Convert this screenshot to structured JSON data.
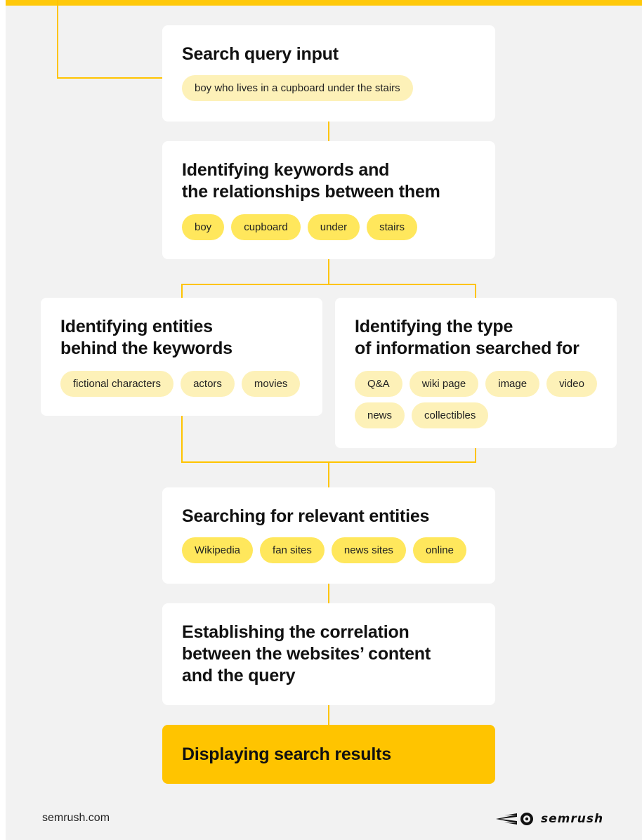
{
  "steps": {
    "query": {
      "title": "Search query input",
      "chips": [
        "boy who lives in a cupboard under the stairs"
      ]
    },
    "keywords": {
      "title_line1": "Identifying keywords and",
      "title_line2": "the relationships between them",
      "chips": [
        "boy",
        "cupboard",
        "under",
        "stairs"
      ]
    },
    "entities": {
      "title_line1": "Identifying entities",
      "title_line2": "behind the keywords",
      "chips": [
        "fictional characters",
        "actors",
        "movies"
      ]
    },
    "info_type": {
      "title_line1": "Identifying the type",
      "title_line2": "of information searched for",
      "chips": [
        "Q&A",
        "wiki page",
        "image",
        "video",
        "news",
        "collectibles"
      ]
    },
    "relevant": {
      "title": "Searching for relevant entities",
      "chips": [
        "Wikipedia",
        "fan sites",
        "news sites",
        "online"
      ]
    },
    "correlation": {
      "title_line1": "Establishing the correlation",
      "title_line2": "between the websites’ content",
      "title_line3": "and the query"
    },
    "results": {
      "title": "Displaying search results"
    }
  },
  "footer": {
    "site": "semrush.com",
    "brand": "semrush",
    "brand_icon": "semrush-comet-logo"
  },
  "colors": {
    "connector": "#ffc400",
    "chip_light": "#fdf1b8",
    "chip_bright": "#ffe75c",
    "final_card": "#ffc400",
    "background": "#f2f2f2"
  }
}
